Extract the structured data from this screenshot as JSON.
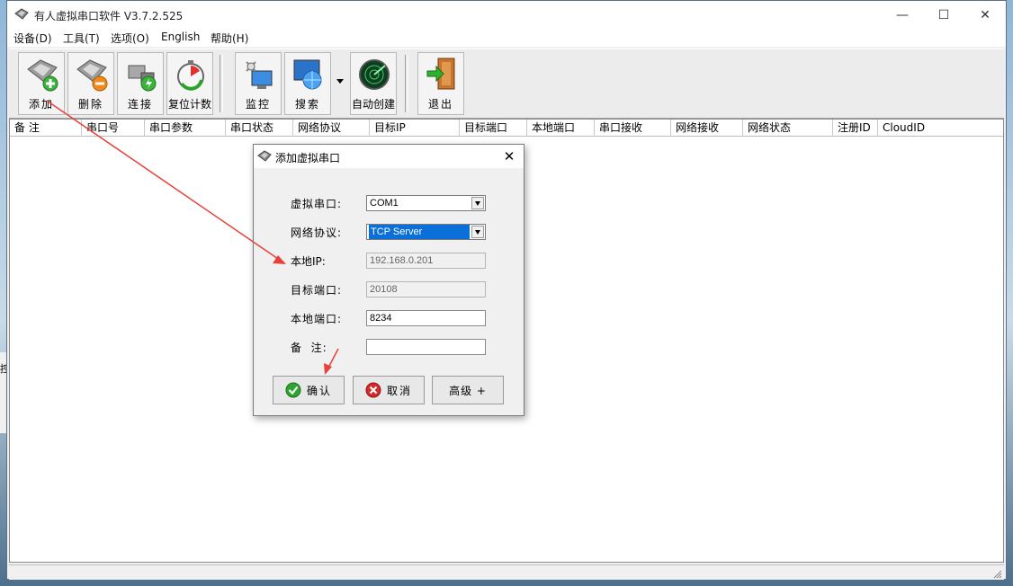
{
  "window": {
    "title": "有人虚拟串口软件 V3.7.2.525",
    "minimize_glyph": "—",
    "maximize_glyph": "☐",
    "close_glyph": "✕"
  },
  "menu": [
    "设备(D)",
    "工具(T)",
    "选项(O)",
    "English",
    "帮助(H)"
  ],
  "toolbar": {
    "add": "添加",
    "delete": "删除",
    "connect": "连接",
    "reset_count": "复位计数",
    "monitor": "监控",
    "search": "搜索",
    "auto_create": "自动创建",
    "exit": "退出"
  },
  "table": {
    "columns": [
      "备 注",
      "串口号",
      "串口参数",
      "串口状态",
      "网络协议",
      "目标IP",
      "目标端口",
      "本地端口",
      "串口接收",
      "网络接收",
      "网络状态",
      "注册ID",
      "CloudID"
    ]
  },
  "dialog": {
    "title": "添加虚拟串口",
    "close_glyph": "✕",
    "fields": {
      "virtual_port_label": "虚拟串口:",
      "virtual_port_value": "COM1",
      "protocol_label": "网络协议:",
      "protocol_value": "TCP Server",
      "local_ip_label": "本地IP:",
      "local_ip_value": "192.168.0.201",
      "target_port_label": "目标端口:",
      "target_port_value": "20108",
      "local_port_label": "本地端口:",
      "local_port_value": "8234",
      "remark_label": "备  注:",
      "remark_value": ""
    },
    "buttons": {
      "confirm": "确认",
      "cancel": "取消",
      "advanced": "高级 +"
    }
  },
  "desktop_strip_char": "控",
  "colors": {
    "selection": "#0a6fd8",
    "annotation_arrow": "#e8403a"
  }
}
